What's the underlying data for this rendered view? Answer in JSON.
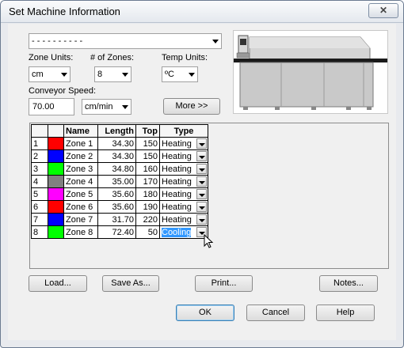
{
  "window": {
    "title": "Set Machine Information",
    "close_glyph": "✕"
  },
  "profile_select": {
    "value": "- - - - - - - - - -"
  },
  "zone_units": {
    "label": "Zone Units:",
    "value": "cm"
  },
  "num_zones": {
    "label": "# of Zones:",
    "value": "8"
  },
  "temp_units": {
    "label": "Temp Units:",
    "value": "ºC"
  },
  "conveyor_speed": {
    "label": "Conveyor Speed:",
    "value": "70.00",
    "unit": "cm/min"
  },
  "more_button": "More >>",
  "table": {
    "headers": [
      "",
      "",
      "Name",
      "Length",
      "Top",
      "Type"
    ],
    "rows": [
      {
        "index": "1",
        "color": "#ff0000",
        "name": "Zone 1",
        "length": "34.30",
        "top": "150",
        "type": "Heating"
      },
      {
        "index": "2",
        "color": "#0000ff",
        "name": "Zone 2",
        "length": "34.30",
        "top": "150",
        "type": "Heating"
      },
      {
        "index": "3",
        "color": "#00ff00",
        "name": "Zone 3",
        "length": "34.80",
        "top": "160",
        "type": "Heating"
      },
      {
        "index": "4",
        "color": "#808080",
        "name": "Zone 4",
        "length": "35.00",
        "top": "170",
        "type": "Heating"
      },
      {
        "index": "5",
        "color": "#ff00ff",
        "name": "Zone 5",
        "length": "35.60",
        "top": "180",
        "type": "Heating"
      },
      {
        "index": "6",
        "color": "#ff0000",
        "name": "Zone 6",
        "length": "35.60",
        "top": "190",
        "type": "Heating"
      },
      {
        "index": "7",
        "color": "#0000ff",
        "name": "Zone 7",
        "length": "31.70",
        "top": "220",
        "type": "Heating"
      },
      {
        "index": "8",
        "color": "#00ff00",
        "name": "Zone 8",
        "length": "72.40",
        "top": "50",
        "type": "Cooling",
        "selected": true
      }
    ]
  },
  "buttons": {
    "load": "Load...",
    "save_as": "Save As...",
    "print": "Print...",
    "notes": "Notes...",
    "ok": "OK",
    "cancel": "Cancel",
    "help": "Help"
  },
  "icons": {
    "machine": "reflow-oven-icon",
    "cursor": "mouse-pointer-icon"
  }
}
